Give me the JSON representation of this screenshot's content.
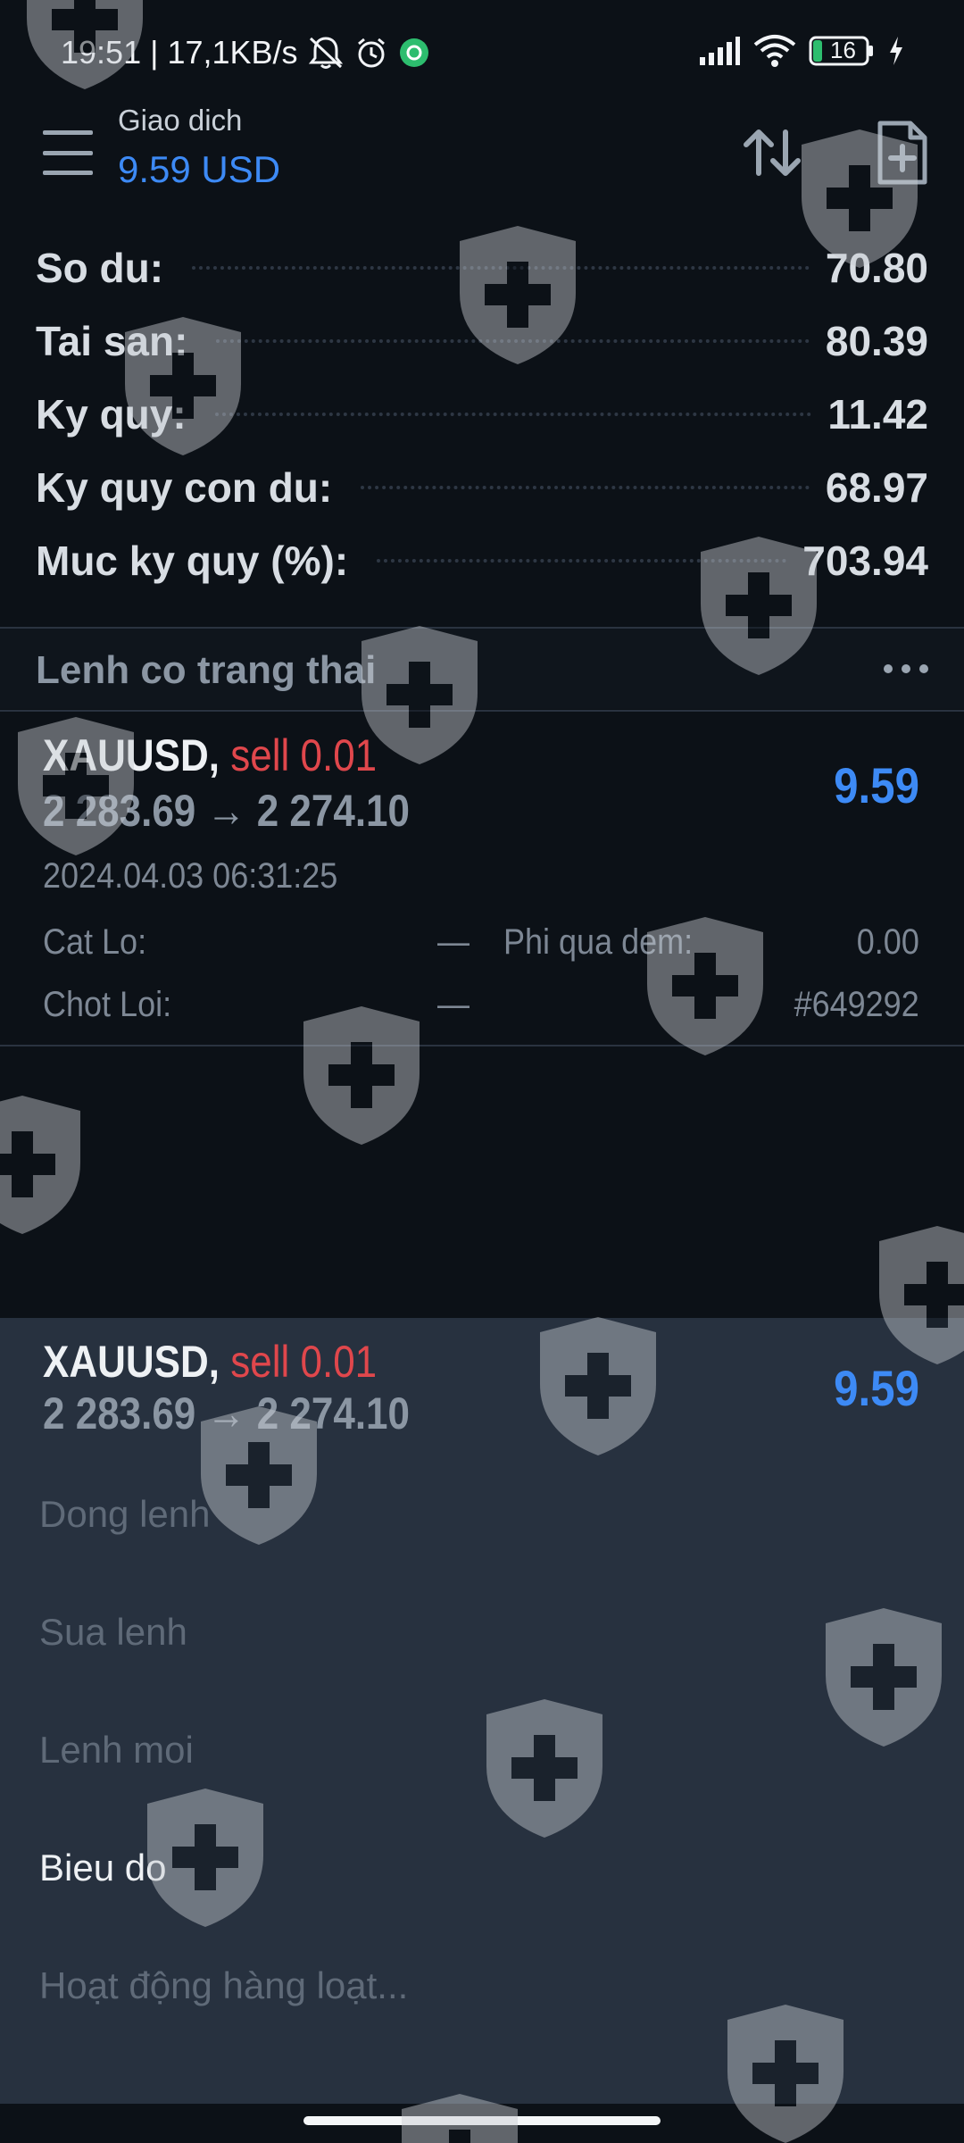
{
  "status_bar": {
    "time_and_speed": "19:51 | 17,1KB/s",
    "battery": "16"
  },
  "app_bar": {
    "title": "Giao dich",
    "balance": "9.59 USD"
  },
  "summary": [
    {
      "label": "So du:",
      "value": "70.80"
    },
    {
      "label": "Tai san:",
      "value": "80.39"
    },
    {
      "label": "Ky quy:",
      "value": "11.42"
    },
    {
      "label": "Ky quy con du:",
      "value": "68.97"
    },
    {
      "label": "Muc ky quy (%):",
      "value": "703.94"
    }
  ],
  "section": {
    "title": "Lenh co trang thai"
  },
  "position": {
    "symbol": "XAUUSD,",
    "side": "sell 0.01",
    "prices": "2 283.69 → 2 274.10",
    "profit": "9.59",
    "time": "2024.04.03 06:31:25",
    "stop_loss_label": "Cat Lo:",
    "stop_loss_value": "—",
    "take_profit_label": "Chot Loi:",
    "take_profit_value": "—",
    "swap_label": "Phi qua dem:",
    "swap_value": "0.00",
    "ticket": "#649292"
  },
  "sheet": {
    "items": [
      {
        "label": "Dong lenh",
        "active": false
      },
      {
        "label": "Sua lenh",
        "active": false
      },
      {
        "label": "Lenh moi",
        "active": false
      },
      {
        "label": "Bieu do",
        "active": true
      },
      {
        "label": "Hoạt động hàng loạt...",
        "active": false
      }
    ]
  },
  "colors": {
    "background": "#0c1117",
    "sheet": "#27313f",
    "accent_blue": "#3d8af5",
    "sell_red": "#e0474c",
    "muted_text": "#7d8794",
    "watermark": "#c8ccd2"
  }
}
